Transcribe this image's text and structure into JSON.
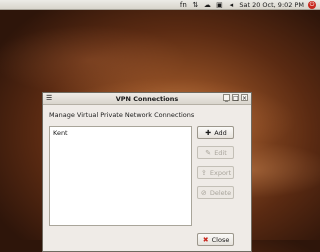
{
  "panel": {
    "icons": [
      "fn-icon",
      "network-icon",
      "weather-icon",
      "printer-icon",
      "volume-icon"
    ],
    "clock": "Sat 20 Oct,  9:02 PM"
  },
  "window": {
    "title": "VPN Connections",
    "heading": "Manage Virtual Private Network Connections",
    "connections": [
      "Kent"
    ],
    "buttons": {
      "add": "Add",
      "edit": "Edit",
      "export": "Export",
      "delete": "Delete",
      "close": "Close"
    }
  }
}
